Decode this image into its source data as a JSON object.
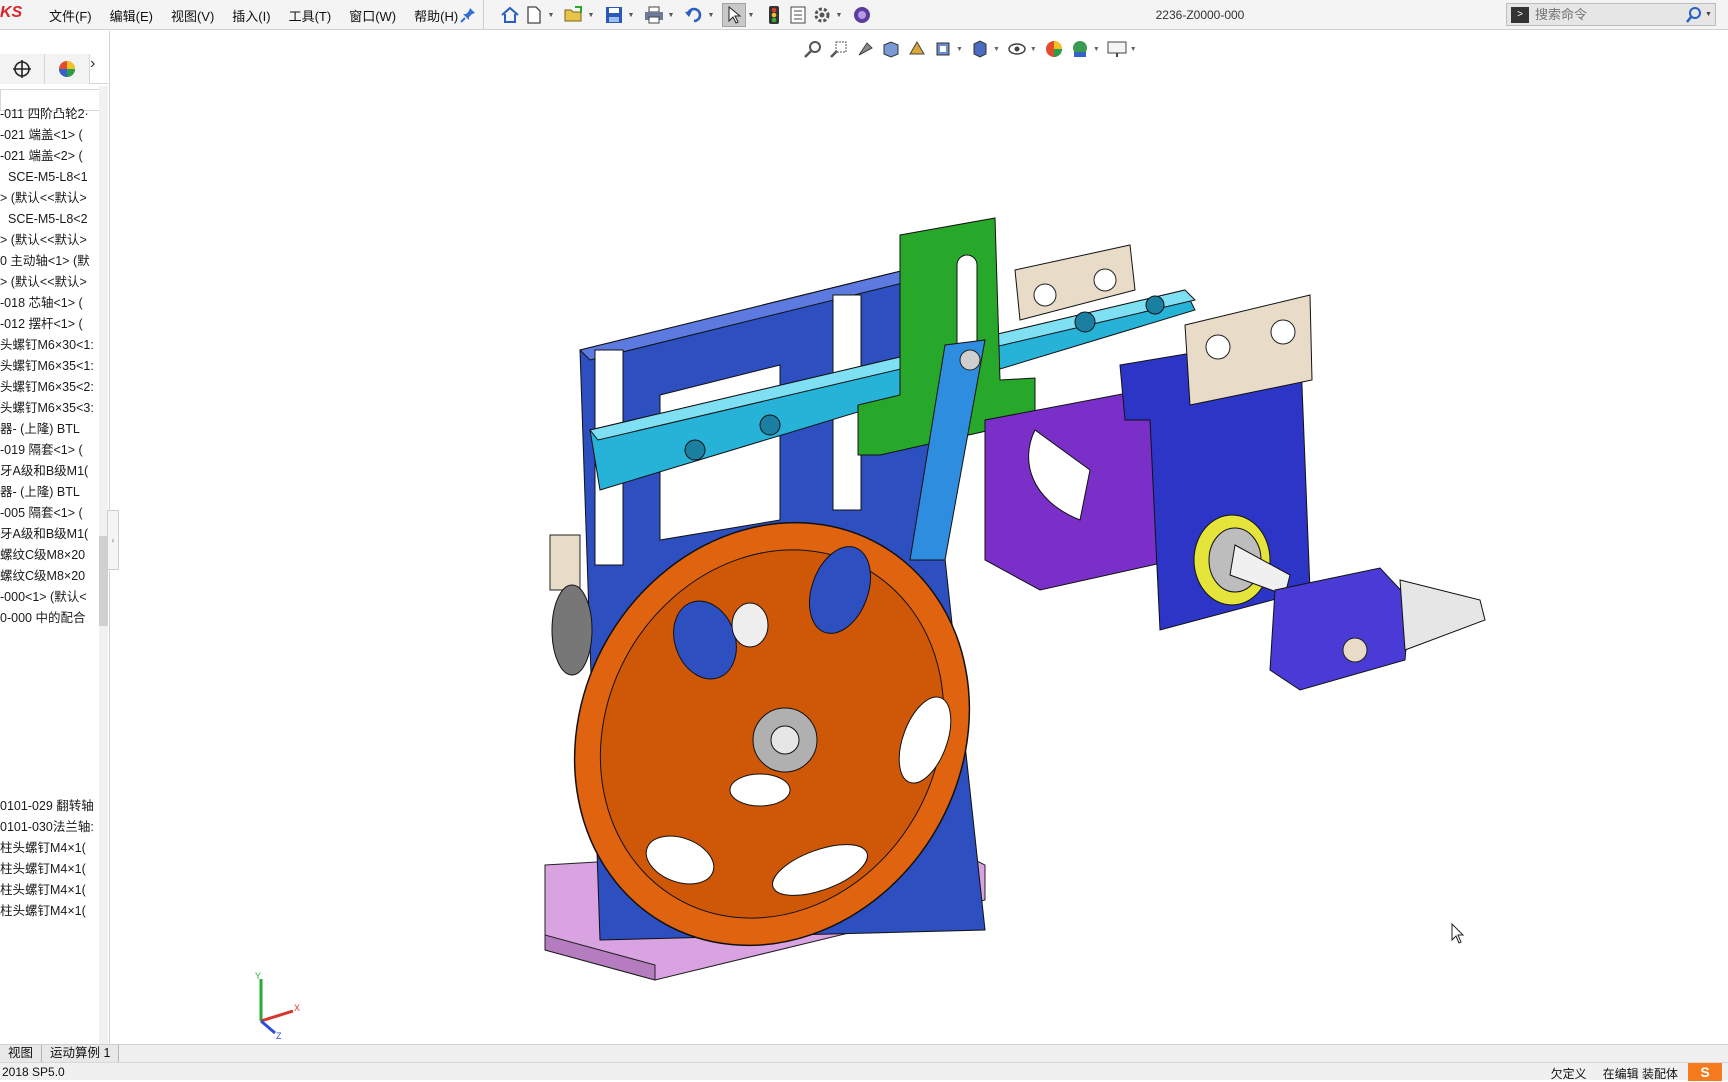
{
  "app": {
    "logo_fragment": "KS",
    "document_title": "2236-Z0000-000"
  },
  "menu": [
    {
      "label": "文件(F)"
    },
    {
      "label": "编辑(E)"
    },
    {
      "label": "视图(V)"
    },
    {
      "label": "插入(I)"
    },
    {
      "label": "工具(T)"
    },
    {
      "label": "窗口(W)"
    },
    {
      "label": "帮助(H)"
    }
  ],
  "toolbar_icons": [
    "home-icon",
    "new-document-icon",
    "open-icon",
    "save-icon",
    "print-icon",
    "undo-icon",
    "select-icon",
    "rebuild-icon",
    "file-properties-icon",
    "options-icon",
    "addins-icon"
  ],
  "search": {
    "placeholder": "搜索命令"
  },
  "hud_icons": [
    "zoom-to-fit-icon",
    "zoom-to-area-icon",
    "previous-view-icon",
    "section-view-icon",
    "dynamic-annotation-icon",
    "view-orientation-icon",
    "display-style-icon",
    "hide-show-items-icon",
    "edit-appearance-icon",
    "apply-scene-icon",
    "view-settings-icon"
  ],
  "tree": {
    "items": [
      "-011 四阶凸轮2·",
      "-021 端盖<1> (",
      "-021 端盖<2> (",
      "SCE-M5-L8<1",
      "> (默认<<默认>",
      "SCE-M5-L8<2",
      "> (默认<<默认>",
      "> (默认<<默认>",
      "0 主动轴<1> (默",
      "-018 芯轴<1> (",
      "-012 摆杆<1> (",
      "头螺钉M6×30<1:",
      "头螺钉M6×35<1:",
      "头螺钉M6×35<2:",
      "头螺钉M6×35<3:",
      "器- (上隆) BTL",
      "-019 隔套<1> (",
      "牙A级和B级M1(",
      "器- (上隆) BTL",
      "-005 隔套<1> (",
      "牙A级和B级M1(",
      "螺纹C级M8×20",
      "螺纹C级M8×20",
      "-000<1> (默认<",
      "0-000 中的配合"
    ],
    "lower_items": [
      "0101-029 翻转轴",
      "0101-030法兰轴:",
      "柱头螺钉M4×1(",
      "柱头螺钉M4×1(",
      "柱头螺钉M4×1(",
      "柱头螺钉M4×1("
    ]
  },
  "bottom_tabs": [
    {
      "label": "视图"
    },
    {
      "label": "运动算例 1"
    }
  ],
  "status": {
    "version": "2018 SP5.0",
    "definition": "欠定义",
    "editing": "在编辑 装配体"
  },
  "triad": {
    "x": "X",
    "y": "Y",
    "z": "Z"
  },
  "colors": {
    "cam_orange": "#e0630f",
    "frame_blue": "#2d4fc0",
    "slide_cyan": "#27b2d8",
    "arm_green": "#27a82b",
    "block_purple": "#7a2fc8",
    "base_pink": "#d9a2e0",
    "plate_tan": "#e8dcc8"
  }
}
